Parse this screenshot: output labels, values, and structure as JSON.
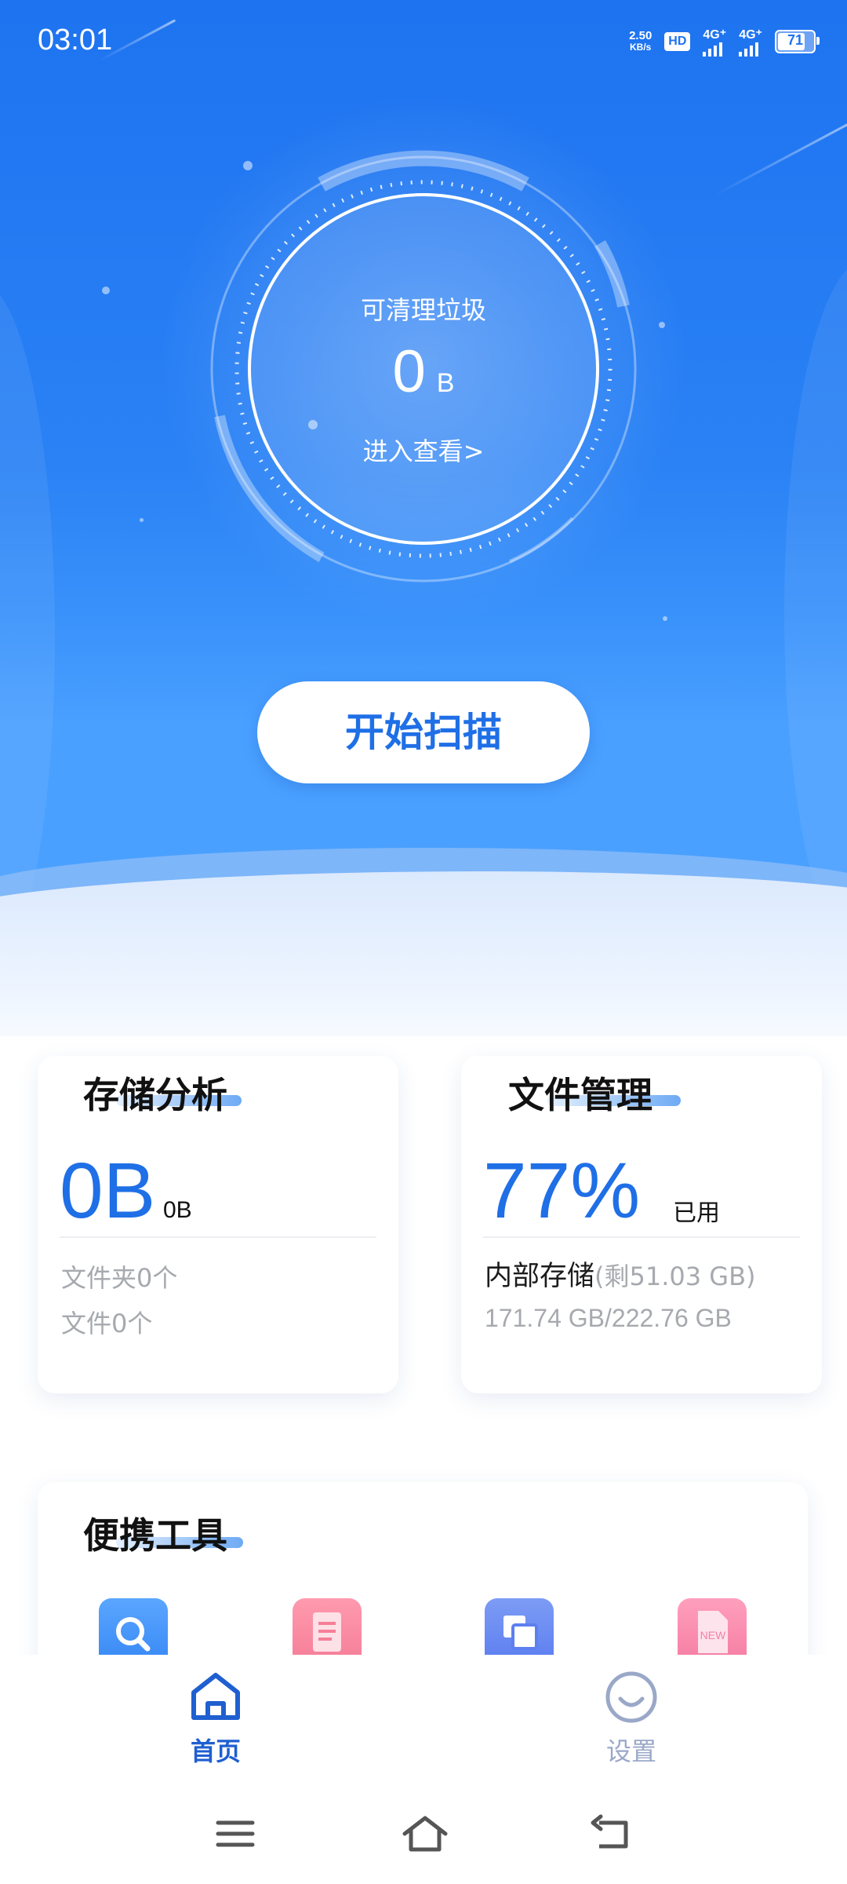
{
  "status_bar": {
    "time": "03:01",
    "net_speed_value": "2.50",
    "net_speed_unit": "KB/s",
    "hd_label": "HD",
    "sim1_label": "4G⁺",
    "sim2_label": "4G⁺",
    "battery_level": "71"
  },
  "hero": {
    "junk_label": "可清理垃圾",
    "junk_value": "0",
    "junk_unit": "B",
    "view_link": "进入查看>",
    "scan_button": "开始扫描"
  },
  "storage_card": {
    "title": "存储分析",
    "value": "0B",
    "suffix": "0B",
    "folders": "文件夹0个",
    "files": "文件0个"
  },
  "file_card": {
    "title": "文件管理",
    "percent": "77%",
    "used_label": "已用",
    "storage_name": "内部存储",
    "remaining": "(剩51.03 GB)",
    "usage": "171.74 GB/222.76 GB"
  },
  "tools_card": {
    "title": "便携工具",
    "icons": [
      "search-icon",
      "document-icon",
      "copy-icon",
      "new-file-icon"
    ]
  },
  "bottom_nav": {
    "home_label": "首页",
    "settings_label": "设置"
  },
  "colors": {
    "primary": "#1f6fe6",
    "hero_top": "#1e73f0",
    "muted_text": "#a6a9ae",
    "nav_active": "#1f5fd0",
    "nav_inactive": "#9aa8c8"
  }
}
